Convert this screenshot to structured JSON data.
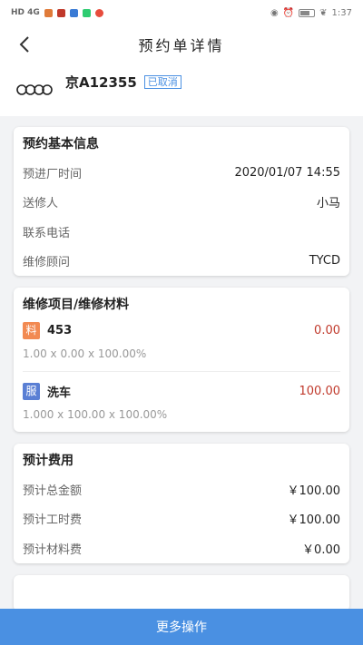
{
  "status_bar": {
    "left_text": "HD 4G",
    "time": "1:37"
  },
  "nav": {
    "title": "预约单详情"
  },
  "car": {
    "plate": "京A12355",
    "status_tag": "已取消",
    "logo": "audi-rings-icon"
  },
  "basic_info": {
    "title": "预约基本信息",
    "rows": [
      {
        "label": "预进厂时间",
        "value": "2020/01/07 14:55"
      },
      {
        "label": "送修人",
        "value": "小马"
      },
      {
        "label": "联系电话",
        "value": ""
      },
      {
        "label": "维修顾问",
        "value": "TYCD"
      }
    ]
  },
  "repair_items": {
    "title": "维修项目/维修材料",
    "items": [
      {
        "tag": "料",
        "tag_color": "#f28a52",
        "name": "453",
        "price": "0.00",
        "formula": "1.00 x 0.00 x 100.00%"
      },
      {
        "tag": "服",
        "tag_color": "#5a7fd4",
        "name": "洗车",
        "price": "100.00",
        "formula": "1.000 x 100.00 x 100.00%"
      }
    ]
  },
  "estimate": {
    "title": "预计费用",
    "rows": [
      {
        "label": "预计总金额",
        "value": "￥100.00"
      },
      {
        "label": "预计工时费",
        "value": "￥100.00"
      },
      {
        "label": "预计材料费",
        "value": "￥0.00"
      }
    ]
  },
  "bottom": {
    "button_label": "更多操作"
  },
  "colors": {
    "accent": "#4a90e2",
    "price_red": "#c0392b"
  }
}
